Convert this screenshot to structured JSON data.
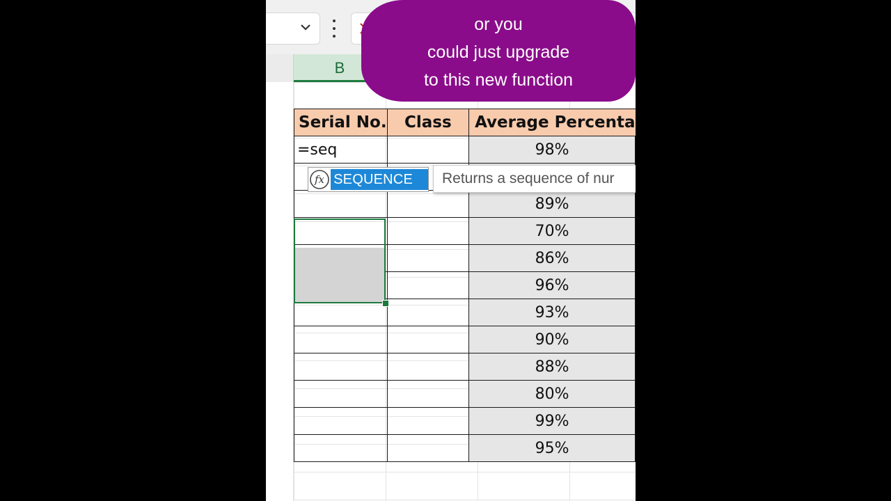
{
  "spreadsheet": {
    "column_b_header": "B",
    "table": {
      "headers": [
        "Serial No.",
        "Class",
        "Average Percenta"
      ],
      "editing_cell_value": "=seq",
      "average_percentages": [
        "98%",
        "",
        "89%",
        "70%",
        "86%",
        "96%",
        "93%",
        "90%",
        "88%",
        "80%",
        "99%",
        "95%"
      ]
    },
    "autocomplete": {
      "function_name": "SEQUENCE",
      "tooltip": "Returns a sequence of nur"
    }
  },
  "caption": {
    "lines": [
      "or you",
      "could just upgrade",
      "to this new function"
    ]
  },
  "colors": {
    "header_fill": "#f8cbad",
    "caption_bg": "#8a0c8a",
    "selection": "#1d7a3e",
    "suggestion_highlight": "#1e88d8"
  }
}
